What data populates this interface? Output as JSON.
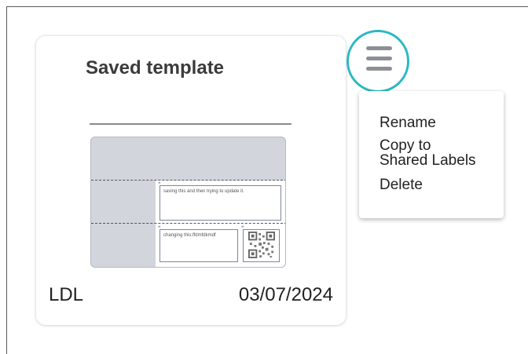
{
  "card": {
    "title": "Saved template",
    "owner": "LDL",
    "date": "03/07/2024",
    "preview": {
      "field_1_text": "saving this and then trying to update it.",
      "field_2_text": "changing this.ffdmfdkmdf"
    }
  },
  "menu": {
    "button_icon": "hamburger-menu-icon",
    "accent_color": "#2bb9c3",
    "items": [
      {
        "label": "Rename"
      },
      {
        "label": "Copy to"
      },
      {
        "label": "Shared Labels"
      },
      {
        "label": "Delete"
      }
    ]
  }
}
